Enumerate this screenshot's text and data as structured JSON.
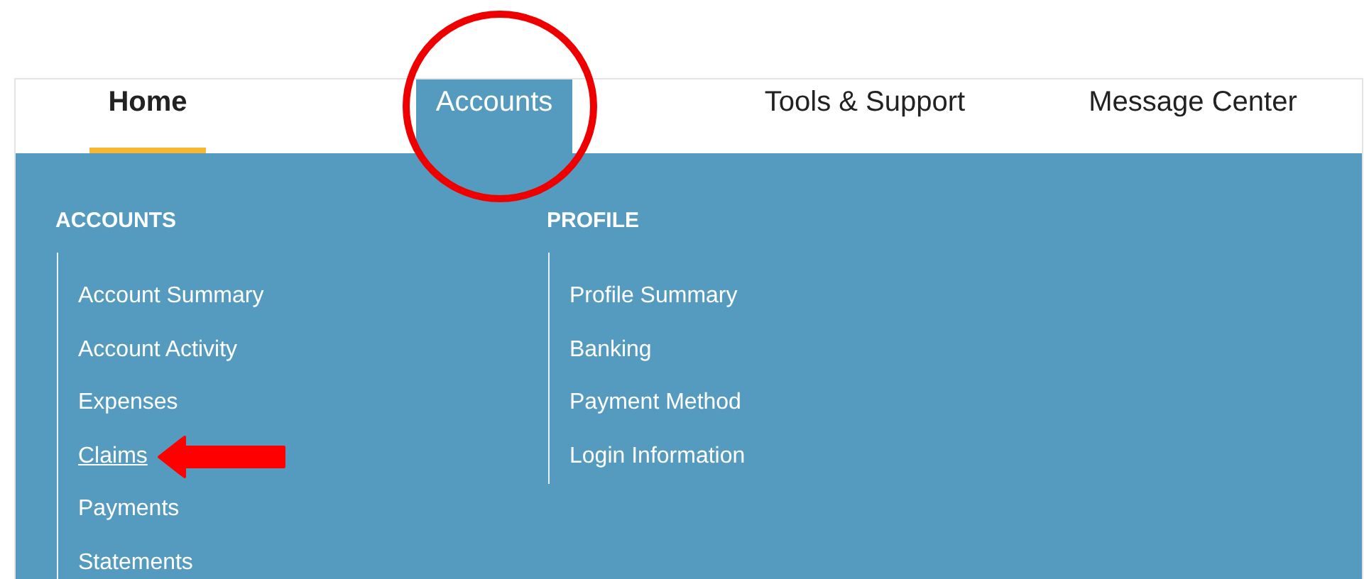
{
  "tabs": [
    {
      "label": "Home",
      "current": true,
      "expanded": false
    },
    {
      "label": "Accounts",
      "current": false,
      "expanded": true
    },
    {
      "label": "Tools & Support",
      "current": false,
      "expanded": false
    },
    {
      "label": "Message Center",
      "current": false,
      "expanded": false
    }
  ],
  "menu_columns": [
    {
      "heading": "ACCOUNTS",
      "items": [
        {
          "label": "Account Summary",
          "hovered": false
        },
        {
          "label": "Account Activity",
          "hovered": false
        },
        {
          "label": "Expenses",
          "hovered": false
        },
        {
          "label": "Claims",
          "hovered": true
        },
        {
          "label": "Payments",
          "hovered": false
        },
        {
          "label": "Statements",
          "hovered": false
        }
      ]
    },
    {
      "heading": "PROFILE",
      "items": [
        {
          "label": "Profile Summary",
          "hovered": false
        },
        {
          "label": "Banking",
          "hovered": false
        },
        {
          "label": "Payment Method",
          "hovered": false
        },
        {
          "label": "Login Information",
          "hovered": false
        }
      ]
    }
  ]
}
